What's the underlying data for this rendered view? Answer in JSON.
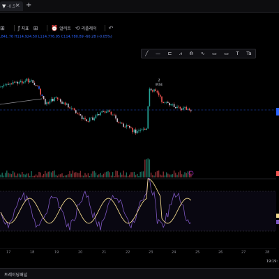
{
  "tab": {
    "label": "-0.5°",
    "close": "×",
    "add": "+"
  },
  "toolbar": {
    "items": [
      {
        "icon": "⊞",
        "label": ""
      },
      {
        "icon": "ƒ",
        "label": "지표"
      },
      {
        "icon": "⊞",
        "label": ""
      },
      {
        "icon": "⏰",
        "label": "얼러트"
      },
      {
        "icon": "⟲",
        "label": "리플레이"
      },
      {
        "icon": "↶",
        "label": ""
      }
    ]
  },
  "ohlc": {
    "open": ",841.76",
    "high": "H114,924.50",
    "low": "L114,776.95",
    "close": "C114,780.89",
    "change": "-60.28 (-0.05%)"
  },
  "drawing_tools": [
    "╱",
    "—",
    "⊏",
    "⩘",
    "⟰",
    "∿",
    "▭",
    "▭",
    "T",
    "Ta"
  ],
  "annotation": {
    "badge": "2",
    "text": "INSE"
  },
  "time_axis": [
    "17",
    "18",
    "19",
    "20",
    "21",
    "22",
    "23",
    "24",
    "25",
    "26",
    "27",
    "28"
  ],
  "clock": "19:19:",
  "bottom_panel": {
    "label": "트레이딩패널"
  },
  "colors": {
    "up": "#26a69a",
    "down": "#ef5350",
    "price": "#2962ff",
    "stoch_k": "#7e57c2",
    "stoch_d": "#f0d78c"
  }
}
